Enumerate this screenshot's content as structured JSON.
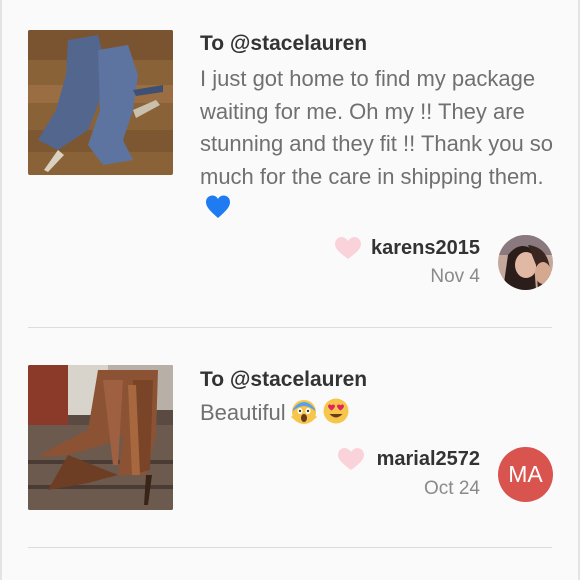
{
  "reviews": [
    {
      "to": "To @stacelauren",
      "message": "I just got home to find my package waiting for me. Oh my !! They are stunning and they fit !! Thank you so much for the care in shipping them.",
      "emojis": [
        "blue-heart-emoji"
      ],
      "username": "karens2015",
      "date": "Nov 4",
      "avatar": {
        "type": "photo"
      },
      "product_image": "blue-suede-boots"
    },
    {
      "to": "To @stacelauren",
      "message": "Beautiful",
      "emojis": [
        "screaming-face-emoji",
        "heart-eyes-emoji"
      ],
      "username": "marial2572",
      "date": "Oct 24",
      "avatar": {
        "type": "initials",
        "initials": "MA",
        "color": "#d9534f"
      },
      "product_image": "brown-fringe-boots"
    }
  ],
  "colors": {
    "background": "#fbfafb",
    "heart": "#f9d3d9",
    "divider": "#dcdcde",
    "text_primary": "#333333",
    "text_secondary": "#707070"
  }
}
